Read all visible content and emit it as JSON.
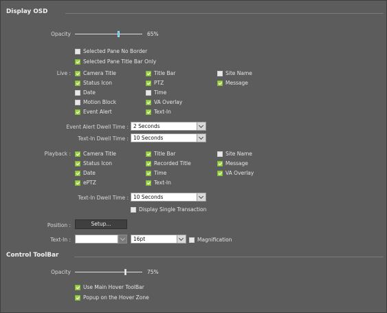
{
  "display_osd": {
    "title": "Display OSD",
    "opacity": {
      "label": "Opacity",
      "value_text": "65%",
      "value": 65
    },
    "pane_options": [
      {
        "label": "Selected Pane No Border",
        "checked": false
      },
      {
        "label": "Selected Pane Title Bar Only",
        "checked": true
      }
    ],
    "live": {
      "label": "Live :",
      "items": [
        {
          "label": "Camera Title",
          "checked": true
        },
        {
          "label": "Title Bar",
          "checked": true
        },
        {
          "label": "Site Name",
          "checked": false
        },
        {
          "label": "Status Icon",
          "checked": true
        },
        {
          "label": "PTZ",
          "checked": true
        },
        {
          "label": "Message",
          "checked": true
        },
        {
          "label": "Date",
          "checked": false
        },
        {
          "label": "Time",
          "checked": false
        },
        {
          "label": "Motion Block",
          "checked": false
        },
        {
          "label": "VA Overlay",
          "checked": true
        },
        {
          "label": "Event Alert",
          "checked": true
        },
        {
          "label": "Text-In",
          "checked": true
        }
      ]
    },
    "event_alert_dwell": {
      "label": "Event Alert Dwell Time :",
      "value": "2 Seconds"
    },
    "text_in_dwell_live": {
      "label": "Text-In Dwell Time :",
      "value": "10 Seconds"
    },
    "playback": {
      "label": "Playback :",
      "items": [
        {
          "label": "Camera Title",
          "checked": true
        },
        {
          "label": "Title Bar",
          "checked": true
        },
        {
          "label": "Site Name",
          "checked": false
        },
        {
          "label": "Status Icon",
          "checked": true
        },
        {
          "label": "Recorded Title",
          "checked": true
        },
        {
          "label": "Message",
          "checked": true
        },
        {
          "label": "Date",
          "checked": true
        },
        {
          "label": "Time",
          "checked": true
        },
        {
          "label": "VA Overlay",
          "checked": true
        },
        {
          "label": "ePTZ",
          "checked": true
        },
        {
          "label": "Text-In",
          "checked": true
        }
      ]
    },
    "text_in_dwell_playback": {
      "label": "Text-In Dwell Time :",
      "value": "10 Seconds"
    },
    "display_single_transaction": {
      "label": "Display Single Transaction",
      "checked": false
    },
    "position": {
      "label": "Position :",
      "button": "Setup..."
    },
    "text_in": {
      "label": "Text-In :",
      "font_size": "16pt",
      "magnification_label": "Magnification",
      "magnification_checked": false
    }
  },
  "control_toolbar": {
    "title": "Control ToolBar",
    "opacity": {
      "label": "Opacity",
      "value_text": "75%",
      "value": 75
    },
    "use_main_hover": {
      "label": "Use Main Hover ToolBar",
      "checked": true
    },
    "popup_hover_zone": {
      "label": "Popup on the Hover Zone",
      "checked": true
    }
  }
}
